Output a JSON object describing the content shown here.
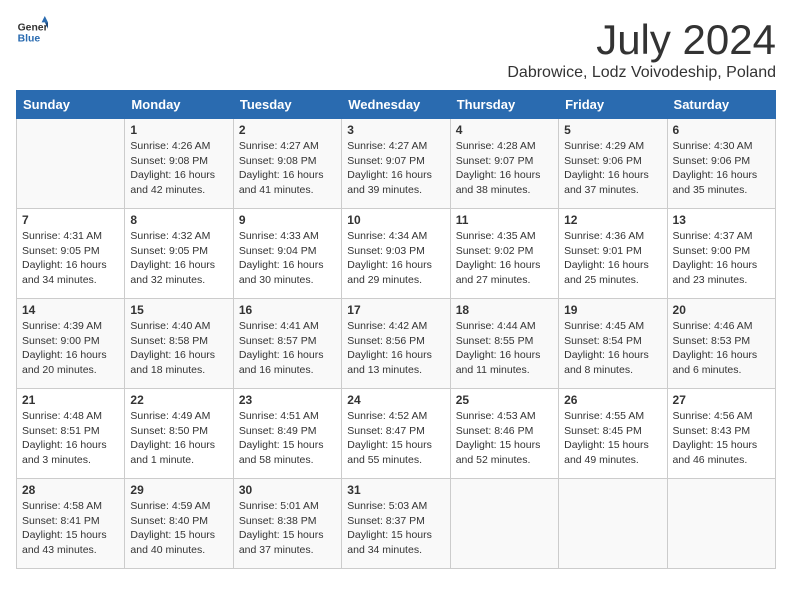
{
  "header": {
    "logo_general": "General",
    "logo_blue": "Blue",
    "month": "July 2024",
    "location": "Dabrowice, Lodz Voivodeship, Poland"
  },
  "weekdays": [
    "Sunday",
    "Monday",
    "Tuesday",
    "Wednesday",
    "Thursday",
    "Friday",
    "Saturday"
  ],
  "weeks": [
    [
      {
        "day": "",
        "info": ""
      },
      {
        "day": "1",
        "info": "Sunrise: 4:26 AM\nSunset: 9:08 PM\nDaylight: 16 hours\nand 42 minutes."
      },
      {
        "day": "2",
        "info": "Sunrise: 4:27 AM\nSunset: 9:08 PM\nDaylight: 16 hours\nand 41 minutes."
      },
      {
        "day": "3",
        "info": "Sunrise: 4:27 AM\nSunset: 9:07 PM\nDaylight: 16 hours\nand 39 minutes."
      },
      {
        "day": "4",
        "info": "Sunrise: 4:28 AM\nSunset: 9:07 PM\nDaylight: 16 hours\nand 38 minutes."
      },
      {
        "day": "5",
        "info": "Sunrise: 4:29 AM\nSunset: 9:06 PM\nDaylight: 16 hours\nand 37 minutes."
      },
      {
        "day": "6",
        "info": "Sunrise: 4:30 AM\nSunset: 9:06 PM\nDaylight: 16 hours\nand 35 minutes."
      }
    ],
    [
      {
        "day": "7",
        "info": "Sunrise: 4:31 AM\nSunset: 9:05 PM\nDaylight: 16 hours\nand 34 minutes."
      },
      {
        "day": "8",
        "info": "Sunrise: 4:32 AM\nSunset: 9:05 PM\nDaylight: 16 hours\nand 32 minutes."
      },
      {
        "day": "9",
        "info": "Sunrise: 4:33 AM\nSunset: 9:04 PM\nDaylight: 16 hours\nand 30 minutes."
      },
      {
        "day": "10",
        "info": "Sunrise: 4:34 AM\nSunset: 9:03 PM\nDaylight: 16 hours\nand 29 minutes."
      },
      {
        "day": "11",
        "info": "Sunrise: 4:35 AM\nSunset: 9:02 PM\nDaylight: 16 hours\nand 27 minutes."
      },
      {
        "day": "12",
        "info": "Sunrise: 4:36 AM\nSunset: 9:01 PM\nDaylight: 16 hours\nand 25 minutes."
      },
      {
        "day": "13",
        "info": "Sunrise: 4:37 AM\nSunset: 9:00 PM\nDaylight: 16 hours\nand 23 minutes."
      }
    ],
    [
      {
        "day": "14",
        "info": "Sunrise: 4:39 AM\nSunset: 9:00 PM\nDaylight: 16 hours\nand 20 minutes."
      },
      {
        "day": "15",
        "info": "Sunrise: 4:40 AM\nSunset: 8:58 PM\nDaylight: 16 hours\nand 18 minutes."
      },
      {
        "day": "16",
        "info": "Sunrise: 4:41 AM\nSunset: 8:57 PM\nDaylight: 16 hours\nand 16 minutes."
      },
      {
        "day": "17",
        "info": "Sunrise: 4:42 AM\nSunset: 8:56 PM\nDaylight: 16 hours\nand 13 minutes."
      },
      {
        "day": "18",
        "info": "Sunrise: 4:44 AM\nSunset: 8:55 PM\nDaylight: 16 hours\nand 11 minutes."
      },
      {
        "day": "19",
        "info": "Sunrise: 4:45 AM\nSunset: 8:54 PM\nDaylight: 16 hours\nand 8 minutes."
      },
      {
        "day": "20",
        "info": "Sunrise: 4:46 AM\nSunset: 8:53 PM\nDaylight: 16 hours\nand 6 minutes."
      }
    ],
    [
      {
        "day": "21",
        "info": "Sunrise: 4:48 AM\nSunset: 8:51 PM\nDaylight: 16 hours\nand 3 minutes."
      },
      {
        "day": "22",
        "info": "Sunrise: 4:49 AM\nSunset: 8:50 PM\nDaylight: 16 hours\nand 1 minute."
      },
      {
        "day": "23",
        "info": "Sunrise: 4:51 AM\nSunset: 8:49 PM\nDaylight: 15 hours\nand 58 minutes."
      },
      {
        "day": "24",
        "info": "Sunrise: 4:52 AM\nSunset: 8:47 PM\nDaylight: 15 hours\nand 55 minutes."
      },
      {
        "day": "25",
        "info": "Sunrise: 4:53 AM\nSunset: 8:46 PM\nDaylight: 15 hours\nand 52 minutes."
      },
      {
        "day": "26",
        "info": "Sunrise: 4:55 AM\nSunset: 8:45 PM\nDaylight: 15 hours\nand 49 minutes."
      },
      {
        "day": "27",
        "info": "Sunrise: 4:56 AM\nSunset: 8:43 PM\nDaylight: 15 hours\nand 46 minutes."
      }
    ],
    [
      {
        "day": "28",
        "info": "Sunrise: 4:58 AM\nSunset: 8:41 PM\nDaylight: 15 hours\nand 43 minutes."
      },
      {
        "day": "29",
        "info": "Sunrise: 4:59 AM\nSunset: 8:40 PM\nDaylight: 15 hours\nand 40 minutes."
      },
      {
        "day": "30",
        "info": "Sunrise: 5:01 AM\nSunset: 8:38 PM\nDaylight: 15 hours\nand 37 minutes."
      },
      {
        "day": "31",
        "info": "Sunrise: 5:03 AM\nSunset: 8:37 PM\nDaylight: 15 hours\nand 34 minutes."
      },
      {
        "day": "",
        "info": ""
      },
      {
        "day": "",
        "info": ""
      },
      {
        "day": "",
        "info": ""
      }
    ]
  ]
}
